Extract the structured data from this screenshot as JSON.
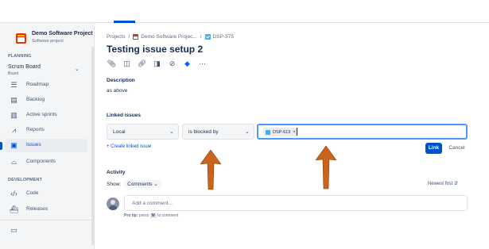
{
  "sidebar": {
    "project_name": "Demo Software Project",
    "project_type": "Software project",
    "planning_label": "PLANNING",
    "board_name": "Scrum Board",
    "board_sub": "Board",
    "items": [
      {
        "label": "Roadmap"
      },
      {
        "label": "Backlog"
      },
      {
        "label": "Active sprints"
      },
      {
        "label": "Reports"
      },
      {
        "label": "Issues"
      },
      {
        "label": "Components"
      }
    ],
    "development_label": "DEVELOPMENT",
    "dev_items": [
      {
        "label": "Code"
      },
      {
        "label": "Releases"
      }
    ]
  },
  "breadcrumb": {
    "projects": "Projects",
    "project": "Demo Software Projec...",
    "issue": "DSP-575"
  },
  "issue": {
    "title": "Testing issue setup 2",
    "description_label": "Description",
    "description_text": "as above"
  },
  "linked": {
    "label": "Linked issues",
    "scope_value": "Local",
    "relation_value": "is blocked by",
    "chip_text": "DSP-613",
    "create_link": "+ Create linked issue",
    "link_button": "Link",
    "cancel_button": "Cancel"
  },
  "activity": {
    "label": "Activity",
    "show_label": "Show:",
    "show_value": "Comments",
    "newest": "Newest first",
    "comment_placeholder": "Add a comment...",
    "pro_tip_prefix": "Pro tip:",
    "pro_tip_press": "press",
    "pro_tip_key": "M",
    "pro_tip_suffix": "to comment"
  },
  "colors": {
    "accent": "#0052cc",
    "focus": "#4c9aff",
    "arrow": "#c9641a"
  }
}
